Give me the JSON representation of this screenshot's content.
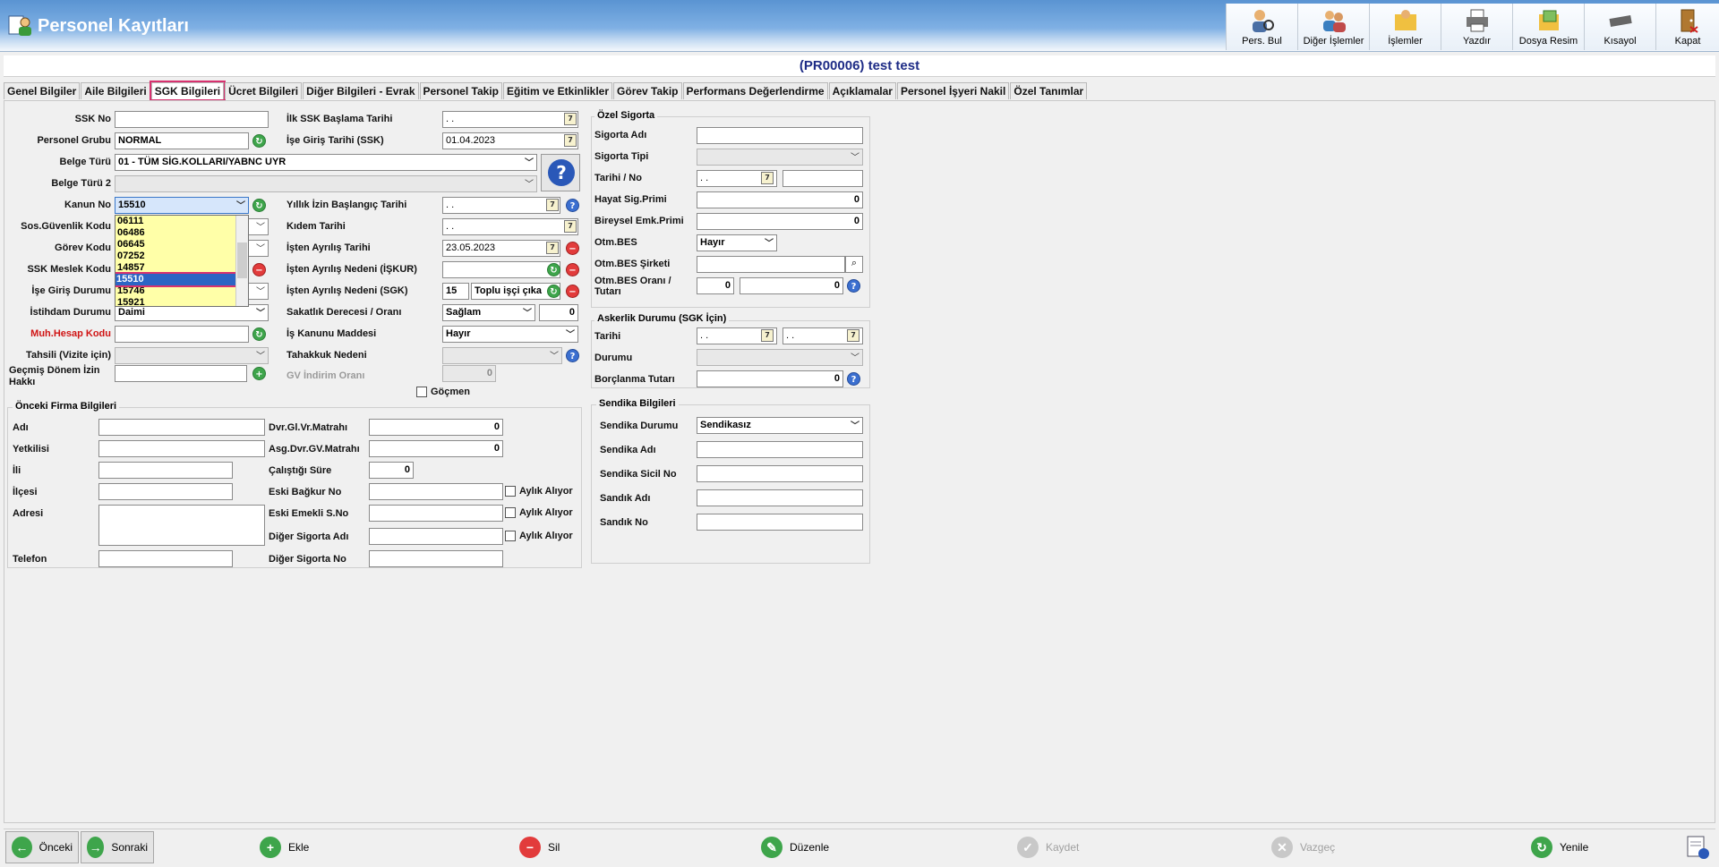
{
  "window": {
    "title": "Personel Kayıtları"
  },
  "toolbar": [
    {
      "label": "Pers. Bul",
      "icon": "person-search-icon"
    },
    {
      "label": "Diğer İşlemler",
      "icon": "people-icon"
    },
    {
      "label": "İşlemler",
      "icon": "folder-people-icon"
    },
    {
      "label": "Yazdır",
      "icon": "printer-icon"
    },
    {
      "label": "Dosya Resim",
      "icon": "image-file-icon"
    },
    {
      "label": "Kısayol",
      "icon": "keyboard-icon"
    },
    {
      "label": "Kapat",
      "icon": "door-exit-icon"
    }
  ],
  "record_title": "(PR00006) test test",
  "tabs": [
    "Genel Bilgiler",
    "Aile Bilgileri",
    "SGK Bilgileri",
    "Ücret Bilgileri",
    "Diğer Bilgileri - Evrak",
    "Personel Takip",
    "Eğitim ve Etkinlikler",
    "Görev Takip",
    "Performans Değerlendirme",
    "Açıklamalar",
    "Personel İşyeri Nakil",
    "Özel Tanımlar"
  ],
  "active_tab": "SGK Bilgileri",
  "sgk": {
    "ssk_no": {
      "label": "SSK No",
      "value": ""
    },
    "personel_grubu": {
      "label": "Personel Grubu",
      "value": "NORMAL"
    },
    "belge_turu": {
      "label": "Belge Türü",
      "value": "01 - TÜM SİG.KOLLARI/YABNC UYR"
    },
    "belge_turu2": {
      "label": "Belge Türü 2",
      "value": ""
    },
    "kanun_no": {
      "label": "Kanun No",
      "value": "15510"
    },
    "sos_guvenlik": {
      "label": "Sos.Güvenlik Kodu"
    },
    "gorev_kodu": {
      "label": "Görev Kodu"
    },
    "ssk_meslek": {
      "label": "SSK Meslek Kodu"
    },
    "ise_giris_durumu": {
      "label": "İşe Giriş Durumu"
    },
    "istihdam_durumu": {
      "label": "İstihdam Durumu",
      "value": "Daimi"
    },
    "muh_hesap": {
      "label": "Muh.Hesap Kodu",
      "value": ""
    },
    "tahsili": {
      "label": "Tahsili (Vizite için)",
      "value": ""
    },
    "gecmis_donem": {
      "label": "Geçmiş Dönem İzin Hakkı",
      "value": ""
    },
    "kanun_options": [
      "06111",
      "06486",
      "06645",
      "07252",
      "14857",
      "15510",
      "15746",
      "15921"
    ],
    "kanun_selected": "15510"
  },
  "dates": {
    "ilk_ssk": {
      "label": "İlk SSK Başlama Tarihi",
      "value": " .  ."
    },
    "ise_giris": {
      "label": "İşe Giriş Tarihi (SSK)",
      "value": "01.04.2023"
    },
    "yillik_izin": {
      "label": "Yıllık İzin Başlangıç Tarihi",
      "value": " .  ."
    },
    "kidem": {
      "label": "Kıdem Tarihi",
      "value": " .  ."
    },
    "isten_ayrilis": {
      "label": "İşten Ayrılış Tarihi",
      "value": "23.05.2023"
    },
    "ayrilis_iskur": {
      "label": "İşten Ayrılış Nedeni (İŞKUR)",
      "value": ""
    },
    "ayrilis_sgk": {
      "label": "İşten Ayrılış Nedeni (SGK)",
      "code": "15",
      "value": "Toplu işçi çıka"
    },
    "sakatlik": {
      "label": "Sakatlık Derecesi / Oranı",
      "value": "Sağlam",
      "rate": "0"
    },
    "is_kanunu": {
      "label": "İş Kanunu Maddesi",
      "value": "Hayır"
    },
    "tahakkuk": {
      "label": "Tahakkuk Nedeni",
      "value": ""
    },
    "gv_indirim": {
      "label": "GV İndirim Oranı",
      "value": "0"
    },
    "gocmen": {
      "label": "Göçmen"
    }
  },
  "ozel_sigorta": {
    "title": "Özel Sigorta",
    "sigorta_adi": {
      "label": "Sigorta Adı",
      "value": ""
    },
    "sigorta_tipi": {
      "label": "Sigorta Tipi",
      "value": ""
    },
    "tarih_no": {
      "label": "Tarihi / No",
      "date": " .  .",
      "no": ""
    },
    "hayat_sig": {
      "label": "Hayat Sig.Primi",
      "value": "0"
    },
    "bireysel": {
      "label": "Bireysel Emk.Primi",
      "value": "0"
    },
    "otm_bes": {
      "label": "Otm.BES",
      "value": "Hayır"
    },
    "otm_bes_sirketi": {
      "label": "Otm.BES Şirketi",
      "value": ""
    },
    "otm_bes_orani": {
      "label": "Otm.BES Oranı / Tutarı",
      "rate": "0",
      "amount": "0"
    }
  },
  "askerlik": {
    "title": "Askerlik Durumu (SGK İçin)",
    "tarihi": {
      "label": "Tarihi",
      "from": " .  .",
      "to": " .  ."
    },
    "durumu": {
      "label": "Durumu",
      "value": ""
    },
    "borclanma": {
      "label": "Borçlanma Tutarı",
      "value": "0"
    }
  },
  "sendika": {
    "title": "Sendika Bilgileri",
    "durum": {
      "label": "Sendika Durumu",
      "value": "Sendikasız"
    },
    "adi": {
      "label": "Sendika Adı",
      "value": ""
    },
    "sicil": {
      "label": "Sendika Sicil No",
      "value": ""
    },
    "sandik_adi": {
      "label": "Sandık Adı",
      "value": ""
    },
    "sandik_no": {
      "label": "Sandık No",
      "value": ""
    }
  },
  "onceki_firma": {
    "title": "Önceki Firma Bilgileri",
    "adi": {
      "label": "Adı",
      "value": ""
    },
    "yetkilisi": {
      "label": "Yetkilisi",
      "value": ""
    },
    "ili": {
      "label": "İli",
      "value": ""
    },
    "ilcesi": {
      "label": "İlçesi",
      "value": ""
    },
    "adresi": {
      "label": "Adresi",
      "value": ""
    },
    "telefon": {
      "label": "Telefon",
      "value": ""
    },
    "dvr_gl": {
      "label": "Dvr.Gl.Vr.Matrahı",
      "value": "0"
    },
    "asg_dvr": {
      "label": "Asg.Dvr.GV.Matrahı",
      "value": "0"
    },
    "calistigi_sure": {
      "label": "Çalıştığı Süre",
      "value": "0"
    },
    "eski_bagkur": {
      "label": "Eski Bağkur No",
      "value": ""
    },
    "eski_emekli": {
      "label": "Eski Emekli S.No",
      "value": ""
    },
    "diger_sig_adi": {
      "label": "Diğer Sigorta Adı",
      "value": ""
    },
    "diger_sig_no": {
      "label": "Diğer Sigorta No",
      "value": ""
    },
    "aylik_aliyor": "Aylık Alıyor"
  },
  "bottom": {
    "onceki": "Önceki",
    "sonraki": "Sonraki",
    "ekle": "Ekle",
    "sil": "Sil",
    "duzenle": "Düzenle",
    "kaydet": "Kaydet",
    "vazgec": "Vazgeç",
    "yenile": "Yenile"
  },
  "colors": {
    "accent_red": "#d01414",
    "highlight": "#d8326f",
    "title_blue": "#1e2c86",
    "dropdown_bg": "#ffffa8"
  }
}
